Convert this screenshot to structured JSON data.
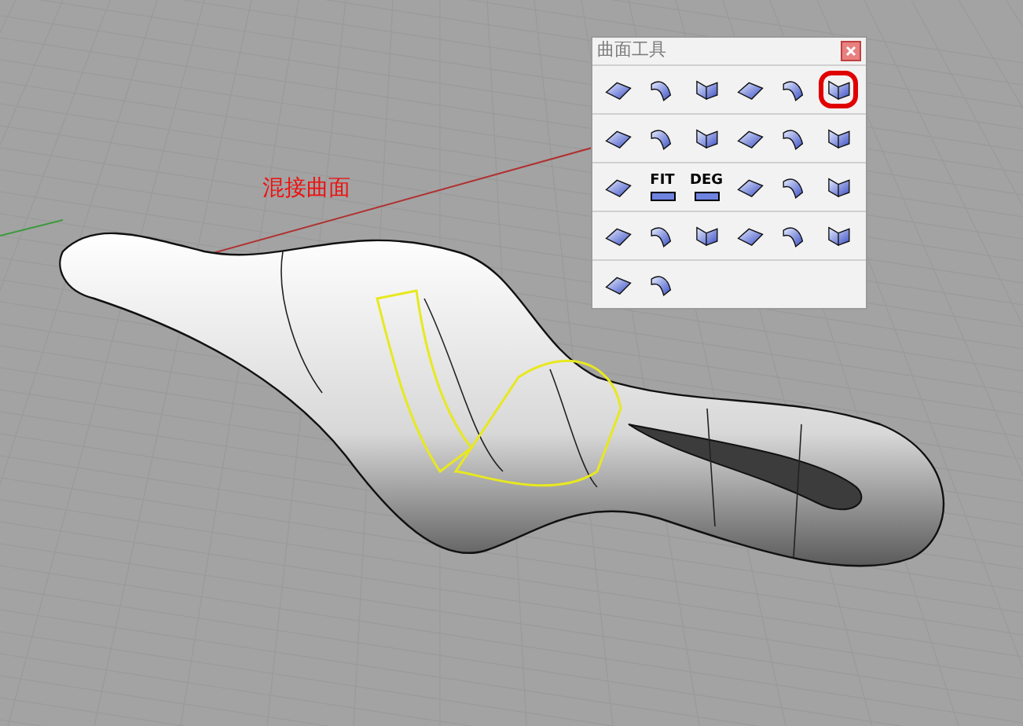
{
  "viewport": {
    "label": "混接曲面"
  },
  "toolbar": {
    "title": "曲面工具",
    "rows": [
      [
        {
          "kind": "icon",
          "highlighted": false
        },
        {
          "kind": "icon",
          "highlighted": false
        },
        {
          "kind": "icon",
          "highlighted": false
        },
        {
          "kind": "icon",
          "highlighted": false
        },
        {
          "kind": "icon",
          "highlighted": false
        },
        {
          "kind": "icon",
          "highlighted": true
        }
      ],
      [
        {
          "kind": "icon",
          "highlighted": false
        },
        {
          "kind": "icon",
          "highlighted": false
        },
        {
          "kind": "icon",
          "highlighted": false
        },
        {
          "kind": "icon",
          "highlighted": false
        },
        {
          "kind": "icon",
          "highlighted": false
        },
        {
          "kind": "icon",
          "highlighted": false
        }
      ],
      [
        {
          "kind": "icon",
          "highlighted": false
        },
        {
          "kind": "text",
          "label": "FIT",
          "highlighted": false
        },
        {
          "kind": "text",
          "label": "DEG",
          "highlighted": false
        },
        {
          "kind": "icon",
          "highlighted": false
        },
        {
          "kind": "icon",
          "highlighted": false
        },
        {
          "kind": "icon",
          "highlighted": false
        }
      ],
      [
        {
          "kind": "icon",
          "highlighted": false
        },
        {
          "kind": "icon",
          "highlighted": false
        },
        {
          "kind": "icon",
          "highlighted": false
        },
        {
          "kind": "icon",
          "highlighted": false
        },
        {
          "kind": "icon",
          "highlighted": false
        },
        {
          "kind": "icon",
          "highlighted": false
        }
      ],
      [
        {
          "kind": "icon",
          "highlighted": false
        },
        {
          "kind": "icon",
          "highlighted": false
        }
      ]
    ]
  }
}
